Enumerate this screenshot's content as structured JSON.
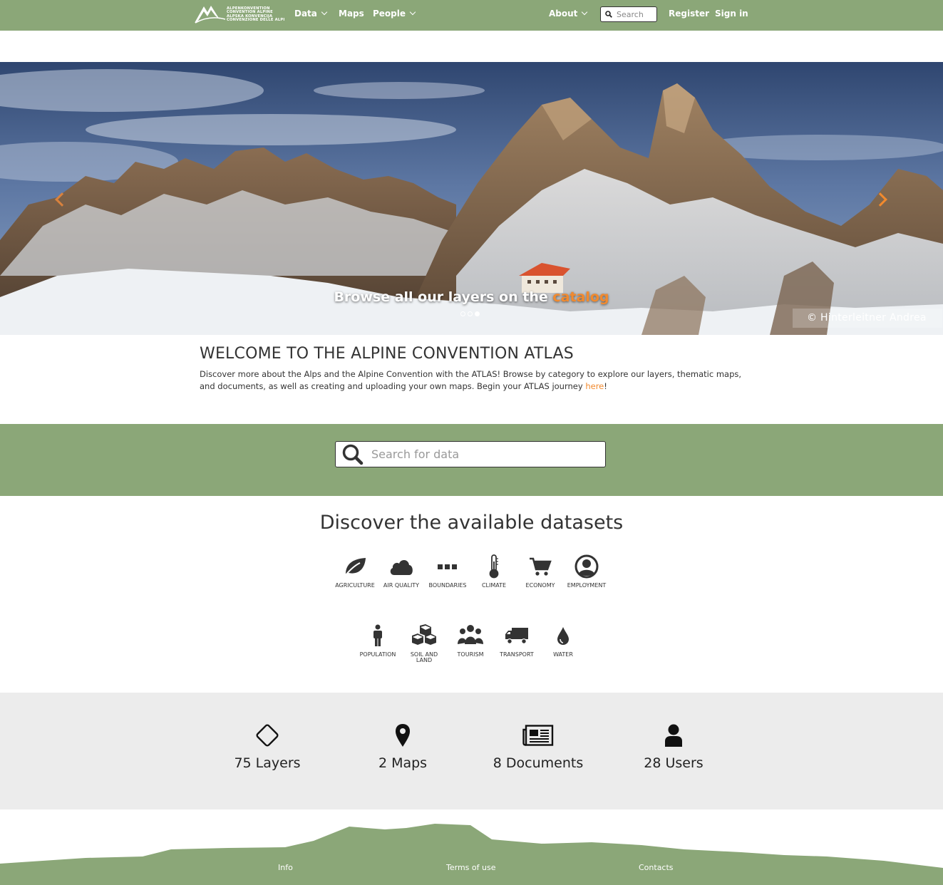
{
  "nav": {
    "logo_lines": [
      "ALPENKONVENTION",
      "CONVENTION ALPINE",
      "ALPSKA KONVENCIJA",
      "CONVENZIONE DELLE ALPI"
    ],
    "data": "Data",
    "maps": "Maps",
    "people": "People",
    "about": "About",
    "search_placeholder": "Search",
    "register": "Register",
    "signin": "Sign in"
  },
  "hero": {
    "caption_prefix": "Browse all our layers on the ",
    "caption_link": "catalog",
    "credit": "© Hinterleitner  Andrea",
    "slides": 3,
    "active_slide": 3
  },
  "welcome": {
    "title": "WELCOME TO THE ALPINE CONVENTION ATLAS",
    "text": "Discover more about the Alps and the Alpine Convention with the ATLAS! Browse by category to explore our layers, thematic maps, and documents, as well as creating and uploading your own maps. Begin your ATLAS journey ",
    "link": "here",
    "suffix": "!"
  },
  "search": {
    "placeholder": "Search for data"
  },
  "datasets": {
    "title": "Discover the available datasets",
    "categories": [
      {
        "label": "AGRICULTURE",
        "icon": "leaf-icon"
      },
      {
        "label": "AIR QUALITY",
        "icon": "cloud-icon"
      },
      {
        "label": "BOUNDARIES",
        "icon": "ellipsis-icon"
      },
      {
        "label": "CLIMATE",
        "icon": "thermometer-icon"
      },
      {
        "label": "ECONOMY",
        "icon": "cart-icon"
      },
      {
        "label": "EMPLOYMENT",
        "icon": "user-circle-icon"
      },
      {
        "label": "POPULATION",
        "icon": "person-icon"
      },
      {
        "label": "SOIL AND LAND",
        "icon": "cubes-icon"
      },
      {
        "label": "TOURISM",
        "icon": "group-icon"
      },
      {
        "label": "TRANSPORT",
        "icon": "truck-icon"
      },
      {
        "label": "WATER",
        "icon": "drop-icon"
      }
    ]
  },
  "stats": [
    {
      "label": "75 Layers",
      "icon": "diamond-icon"
    },
    {
      "label": "2 Maps",
      "icon": "map-marker-icon"
    },
    {
      "label": "8 Documents",
      "icon": "newspaper-icon"
    },
    {
      "label": "28 Users",
      "icon": "user-icon"
    }
  ],
  "footer": {
    "info": "Info",
    "terms": "Terms of use",
    "contacts": "Contacts"
  },
  "colors": {
    "green": "#8ba778",
    "orange": "#f28a2e",
    "grey": "#ececec"
  }
}
